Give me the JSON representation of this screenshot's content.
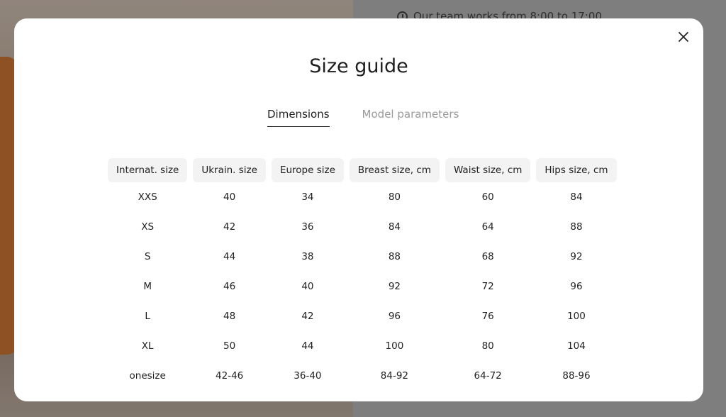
{
  "background": {
    "notice": "Our team works from 8:00 to 17:00"
  },
  "modal": {
    "title": "Size guide",
    "tabs": [
      {
        "label": "Dimensions",
        "active": true
      },
      {
        "label": "Model parameters",
        "active": false
      }
    ],
    "table": {
      "headers": [
        "Internat. size",
        "Ukrain. size",
        "Europe size",
        "Breast size, cm",
        "Waist size, cm",
        "Hips size, cm"
      ],
      "rows": [
        [
          "XXS",
          "40",
          "34",
          "80",
          "60",
          "84"
        ],
        [
          "XS",
          "42",
          "36",
          "84",
          "64",
          "88"
        ],
        [
          "S",
          "44",
          "38",
          "88",
          "68",
          "92"
        ],
        [
          "M",
          "46",
          "40",
          "92",
          "72",
          "96"
        ],
        [
          "L",
          "48",
          "42",
          "96",
          "76",
          "100"
        ],
        [
          "XL",
          "50",
          "44",
          "100",
          "80",
          "104"
        ],
        [
          "onesize",
          "42-46",
          "36-40",
          "84-92",
          "64-72",
          "88-96"
        ]
      ]
    }
  },
  "colors": {
    "text": "#1e1e1e",
    "muted_tab": "#9a9a9a",
    "header_bg": "#f3f3f3"
  }
}
